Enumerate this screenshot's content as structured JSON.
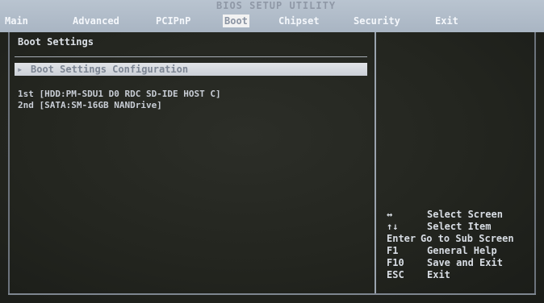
{
  "header": {
    "title": "BIOS SETUP UTILITY",
    "menu": [
      "Main",
      "Advanced",
      "PCIPnP",
      "Boot",
      "Chipset",
      "Security",
      "Exit"
    ],
    "active": "Boot"
  },
  "left": {
    "section_title": "Boot Settings",
    "submenu_label": "Boot Settings Configuration",
    "boot_order": [
      "1st [HDD:PM-SDU1 D0 RDC SD-IDE HOST C]",
      "2nd [SATA:SM-16GB NANDrive]"
    ]
  },
  "help": [
    {
      "key": "↔",
      "desc": "Select Screen"
    },
    {
      "key": "↑↓",
      "desc": "Select Item"
    },
    {
      "key": "Enter",
      "desc": "Go to Sub Screen"
    },
    {
      "key": "F1",
      "desc": "General Help"
    },
    {
      "key": "F10",
      "desc": "Save and Exit"
    },
    {
      "key": "ESC",
      "desc": "Exit"
    }
  ]
}
